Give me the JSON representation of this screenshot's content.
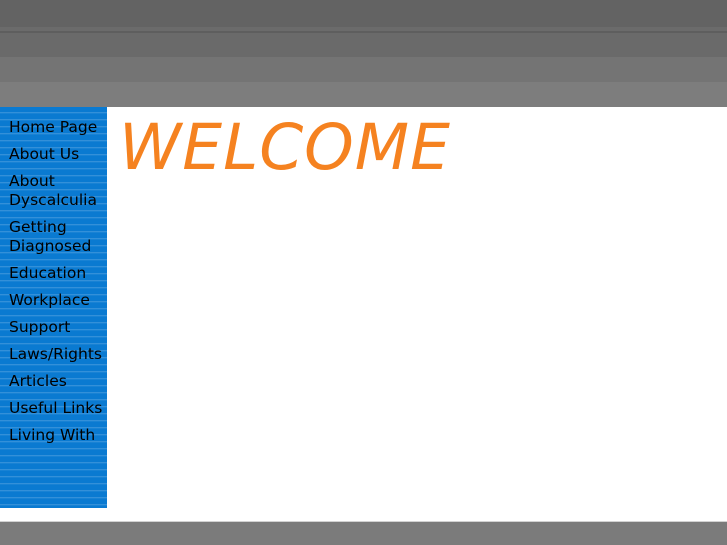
{
  "page": {
    "title": "Dyscalculia website",
    "background_color": "#ffffff"
  },
  "chrome": {
    "bands": [
      {
        "name": "band-1",
        "color": "#636363"
      },
      {
        "name": "band-2",
        "color": "#6b6b6b"
      },
      {
        "name": "band-3",
        "color": "#5e5e5e"
      },
      {
        "name": "band-4",
        "color": "#6a6a6a"
      },
      {
        "name": "band-5",
        "color": "#747474"
      },
      {
        "name": "band-6",
        "color": "#7d7d7d"
      }
    ]
  },
  "sidebar": {
    "background_color": "#0a7ad1",
    "text_color": "#000000",
    "items": [
      {
        "label": "Home Page",
        "multiline": true
      },
      {
        "label": "About Us",
        "multiline": false
      },
      {
        "label": "About Dyscalculia",
        "multiline": true
      },
      {
        "label": "Getting Diagnosed",
        "multiline": true
      },
      {
        "label": "Education",
        "multiline": false
      },
      {
        "label": "Workplace",
        "multiline": false
      },
      {
        "label": "Support",
        "multiline": false
      },
      {
        "label": "Laws/Rights",
        "multiline": false
      },
      {
        "label": "Articles",
        "multiline": false
      },
      {
        "label": "Useful Links",
        "multiline": true
      },
      {
        "label": "Living With",
        "multiline": true
      }
    ]
  },
  "content": {
    "heading": "WELCOME",
    "heading_color": "#f58220"
  },
  "footer": {
    "faint_left": "",
    "faint_right": "",
    "bar_color": "#7b7b7b"
  }
}
